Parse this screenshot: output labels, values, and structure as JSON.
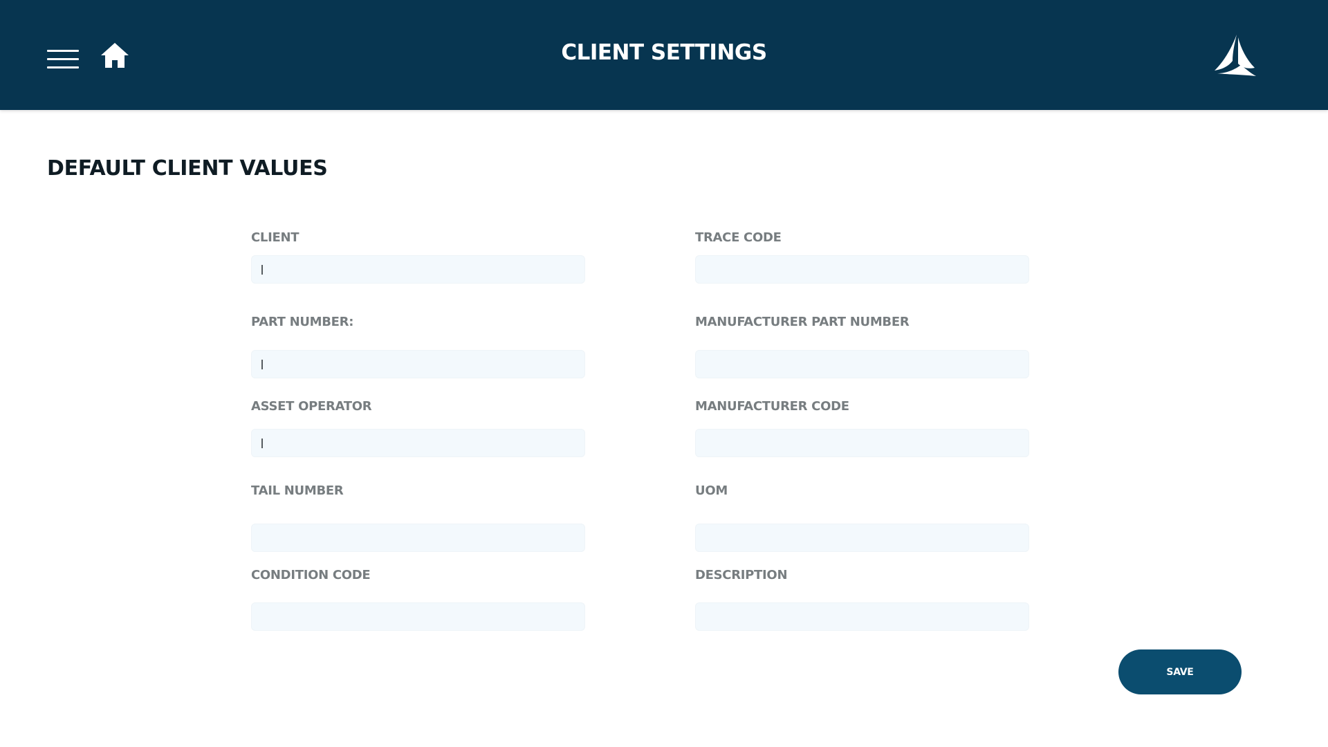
{
  "header": {
    "title": "CLIENT SETTINGS",
    "menu_icon": "hamburger-menu-icon",
    "home_icon": "home-icon",
    "logo": "company-logo",
    "background_color": "#073550"
  },
  "section": {
    "title": "DEFAULT CLIENT VALUES"
  },
  "fields": {
    "client": {
      "label": "CLIENT",
      "value": ""
    },
    "trace_code": {
      "label": "TRACE CODE",
      "value": ""
    },
    "part_number": {
      "label": "PART NUMBER:",
      "value": ""
    },
    "manufacturer_part_number": {
      "label": "MANUFACTURER PART NUMBER",
      "value": ""
    },
    "asset_operator": {
      "label": "ASSET OPERATOR",
      "value": ""
    },
    "manufacturer_code": {
      "label": "MANUFACTURER CODE",
      "value": ""
    },
    "tail_number": {
      "label": "TAIL NUMBER",
      "value": ""
    },
    "uom": {
      "label": "UOM",
      "value": ""
    },
    "condition_code": {
      "label": "CONDITION CODE",
      "value": ""
    },
    "description": {
      "label": "DESCRIPTION",
      "value": ""
    }
  },
  "actions": {
    "save_label": "SAVE",
    "accent_color": "#0b4d6f"
  },
  "colors": {
    "label": "#777d80",
    "input_background": "#f3f9fd"
  }
}
